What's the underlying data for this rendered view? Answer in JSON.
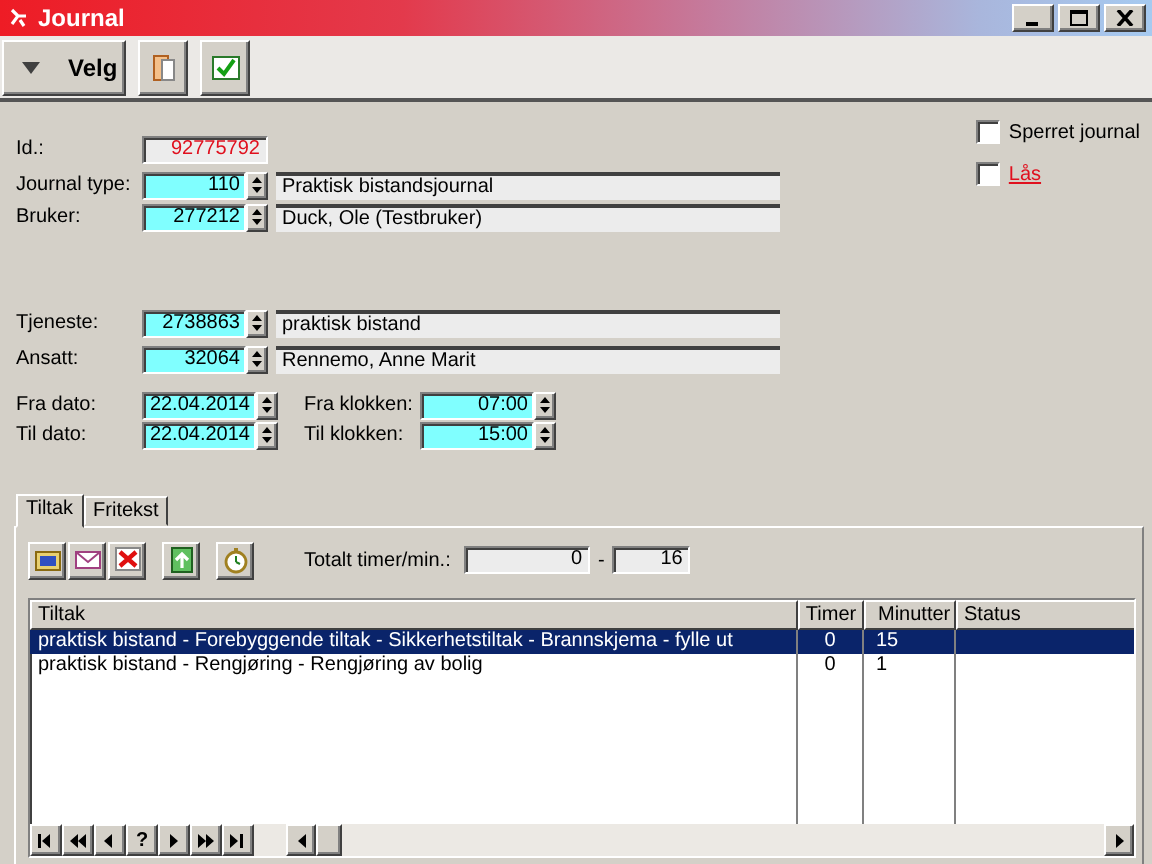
{
  "window": {
    "title": "Journal"
  },
  "toolbar": {
    "menu_button": "Velg"
  },
  "id_field": {
    "label": "Id.:",
    "value": "92775792"
  },
  "flags": [
    {
      "label": "Sperret journal",
      "checked": false,
      "kind": "normal"
    },
    {
      "label": "Lås",
      "checked": false,
      "kind": "alert"
    }
  ],
  "client_fields": [
    {
      "label": "Journal type:",
      "code": "110",
      "description": "Praktisk bistandsjournal"
    },
    {
      "label": "Bruker:",
      "code": "277212",
      "description": "Duck, Ole (Testbruker)"
    }
  ],
  "service_fields": [
    {
      "label": "Tjeneste:",
      "code": "2738863",
      "description": "praktisk bistand"
    },
    {
      "label": "Ansatt:",
      "code": "32064",
      "description": "Rennemo,  Anne Marit"
    }
  ],
  "dates": [
    {
      "label": "Fra dato:",
      "date": "22.04.2014",
      "time_label": "Fra klokken:",
      "time": "07:00"
    },
    {
      "label": "Til dato:",
      "date": "22.04.2014",
      "time_label": "Til klokken:",
      "time": "15:00"
    }
  ],
  "tabs": [
    {
      "label": "Tiltak",
      "selected": true
    },
    {
      "label": "Fritekst",
      "selected": false
    }
  ],
  "totals": {
    "label": "Totalt timer/min.:",
    "hours": "0",
    "separator": "-",
    "minutes": "16"
  },
  "table": {
    "columns": [
      "Tiltak",
      "Timer",
      "Minutter",
      "Status"
    ],
    "rows": [
      {
        "cells": [
          "praktisk bistand - Forebyggende tiltak - Sikkerhetstiltak - Brannskjema - fylle ut",
          "0",
          "15",
          ""
        ],
        "selected": true
      },
      {
        "cells": [
          "praktisk bistand - Rengjøring - Rengjøring av bolig",
          "0",
          "1",
          ""
        ],
        "selected": false
      }
    ]
  },
  "navigator": [
    {
      "kind": "first"
    },
    {
      "kind": "prev-page"
    },
    {
      "kind": "prev"
    },
    {
      "kind": "help",
      "label": "?"
    },
    {
      "kind": "next"
    },
    {
      "kind": "next-page"
    },
    {
      "kind": "last"
    }
  ]
}
